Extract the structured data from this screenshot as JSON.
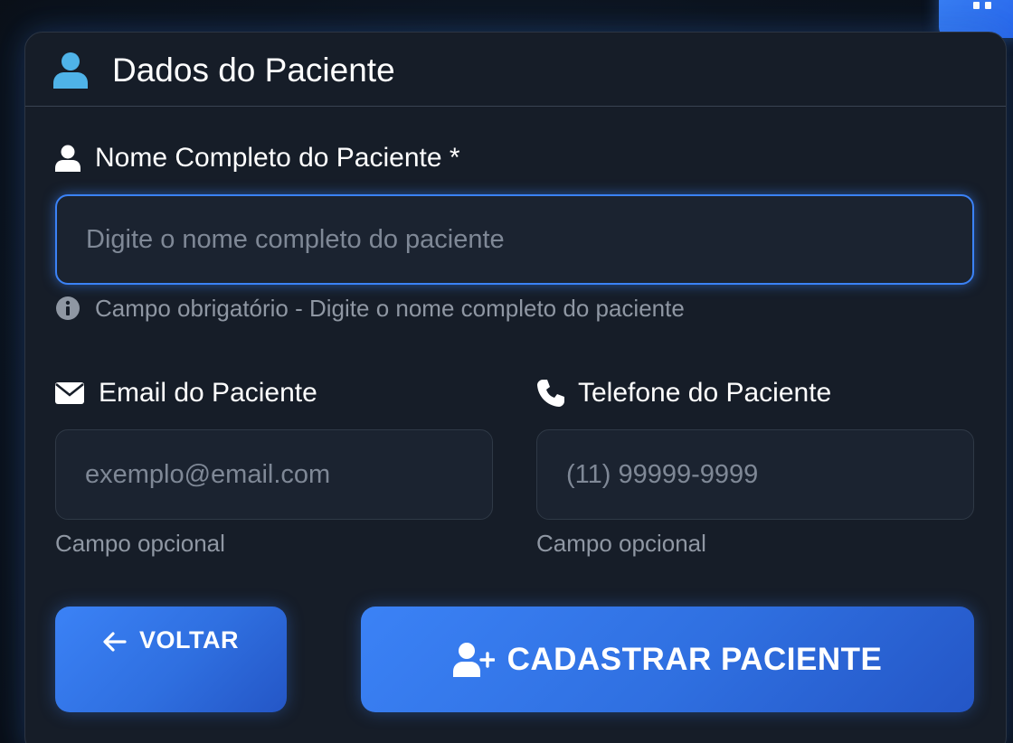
{
  "card": {
    "title": "Dados do Paciente"
  },
  "fields": {
    "name": {
      "label": "Nome Completo do Paciente *",
      "placeholder": "Digite o nome completo do paciente",
      "value": "",
      "help": "Campo obrigatório - Digite o nome completo do paciente",
      "icon": "user-icon"
    },
    "email": {
      "label": "Email do Paciente",
      "placeholder": "exemplo@email.com",
      "value": "",
      "help": "Campo opcional",
      "icon": "envelope-icon"
    },
    "phone": {
      "label": "Telefone do Paciente",
      "placeholder": "(11) 99999-9999",
      "value": "",
      "help": "Campo opcional",
      "icon": "phone-icon"
    }
  },
  "buttons": {
    "back": {
      "label": "VOLTAR",
      "icon": "arrow-left-icon"
    },
    "submit": {
      "label": "CADASTRAR PACIENTE",
      "icon": "user-plus-icon"
    }
  },
  "colors": {
    "accent": "#3b82f6",
    "header_icon": "#4fb3e8",
    "card_bg": "#161d28",
    "page_bg": "#0c131d"
  }
}
